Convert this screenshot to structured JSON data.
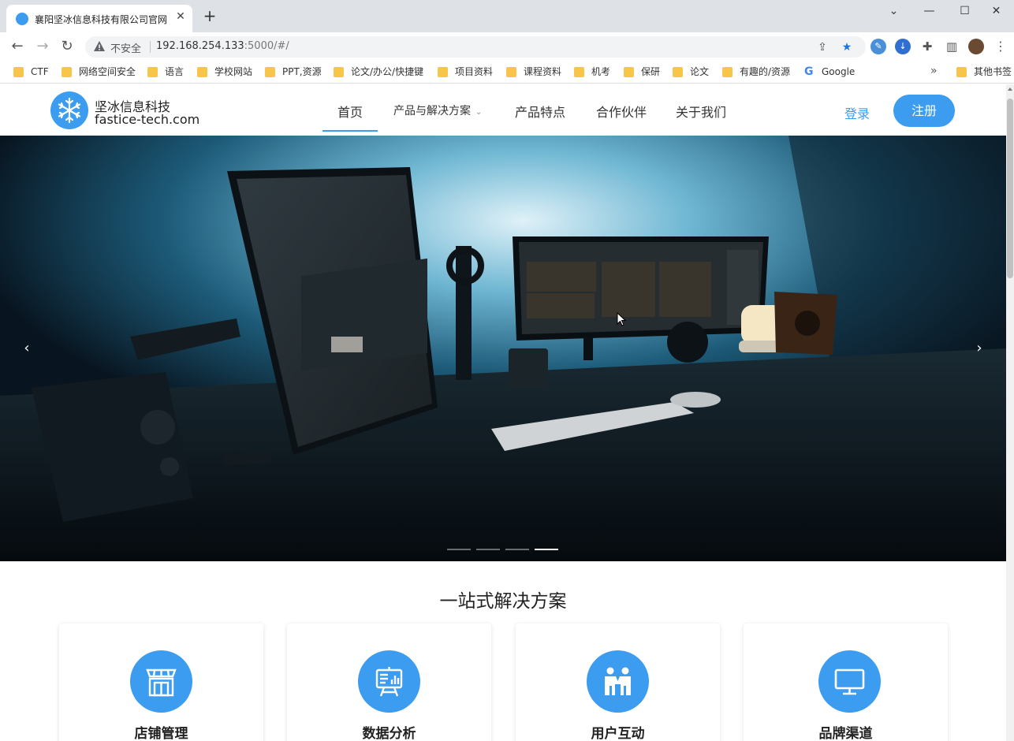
{
  "browser": {
    "tab_title": "襄阳坚冰信息科技有限公司官网",
    "tab_close": "✕",
    "new_tab": "+",
    "window_controls": {
      "chevron": "⌄",
      "minimize": "—",
      "maximize": "☐",
      "close": "✕"
    },
    "nav": {
      "back": "←",
      "forward": "→",
      "reload": "↻"
    },
    "security_label": "不安全",
    "url_host": "192.168.254.133",
    "url_rest": ":5000/#/",
    "bookmarks": [
      {
        "label": "CTF",
        "icon": "folder-icon"
      },
      {
        "label": "网络空间安全",
        "icon": "folder-icon"
      },
      {
        "label": "语言",
        "icon": "folder-icon"
      },
      {
        "label": "学校网站",
        "icon": "folder-icon"
      },
      {
        "label": "PPT,资源",
        "icon": "folder-icon"
      },
      {
        "label": "论文/办公/快捷键",
        "icon": "folder-icon"
      },
      {
        "label": "项目资料",
        "icon": "folder-icon"
      },
      {
        "label": "课程资料",
        "icon": "folder-icon"
      },
      {
        "label": "机考",
        "icon": "folder-icon"
      },
      {
        "label": "保研",
        "icon": "folder-icon"
      },
      {
        "label": "论文",
        "icon": "folder-icon"
      },
      {
        "label": "有趣的/资源",
        "icon": "folder-icon"
      },
      {
        "label": "Google",
        "icon": "google-icon"
      }
    ],
    "bookmarks_more": "»",
    "other_bookmarks": "其他书签"
  },
  "site": {
    "brand_cn": "坚冰信息科技",
    "brand_en": "fastice-tech.com",
    "nav": {
      "home": "首页",
      "products": "产品与解决方案",
      "features": "产品特点",
      "partners": "合作伙伴",
      "about": "关于我们"
    },
    "login": "登录",
    "register": "注册",
    "carousel": {
      "prev": "‹",
      "next": "›",
      "slide_count": 4,
      "active_slide": 4
    },
    "section_title": "一站式解决方案",
    "cards": [
      {
        "title": "店铺管理",
        "icon": "storefront-icon"
      },
      {
        "title": "数据分析",
        "icon": "presentation-chart-icon"
      },
      {
        "title": "用户互动",
        "icon": "users-icon"
      },
      {
        "title": "品牌渠道",
        "icon": "monitor-icon"
      }
    ]
  },
  "colors": {
    "accent": "#3b9cf0",
    "folder": "#f6c54a",
    "tabstrip": "#dee1e6"
  }
}
